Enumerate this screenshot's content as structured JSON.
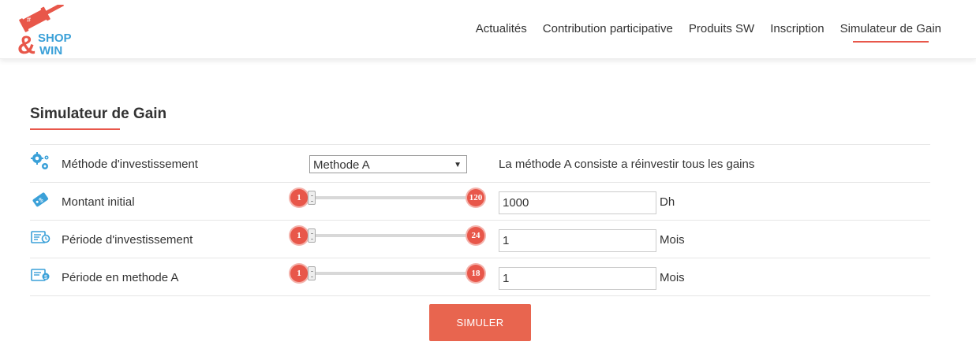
{
  "brand": {
    "logo_text_top": "SHOP",
    "logo_text_bottom": "WIN",
    "logo_ampersand": "&",
    "colors": {
      "accent": "#e8574a",
      "blue": "#3aa0d8"
    }
  },
  "nav": {
    "items": [
      {
        "label": "Actualités"
      },
      {
        "label": "Contribution participative"
      },
      {
        "label": "Produits SW"
      },
      {
        "label": "Inscription"
      },
      {
        "label": "Simulateur de Gain",
        "active": true
      }
    ]
  },
  "page": {
    "title": "Simulateur de Gain"
  },
  "form": {
    "method": {
      "icon": "gears-icon",
      "label": "Méthode d'investissement",
      "selected": "Methode A",
      "description": "La méthode A consiste a réinvestir tous les gains"
    },
    "amount": {
      "icon": "money-tag-icon",
      "label": "Montant initial",
      "slider_min": "1",
      "slider_max": "120",
      "value": "1000",
      "unit": "Dh"
    },
    "period": {
      "icon": "calendar-clock-icon",
      "label": "Période d'investissement",
      "slider_min": "1",
      "slider_max": "24",
      "value": "1",
      "unit": "Mois"
    },
    "period_a": {
      "icon": "calendar-coin-icon",
      "label": "Période en methode A",
      "slider_min": "1",
      "slider_max": "18",
      "value": "1",
      "unit": "Mois"
    }
  },
  "actions": {
    "simulate_label": "SIMULER"
  }
}
